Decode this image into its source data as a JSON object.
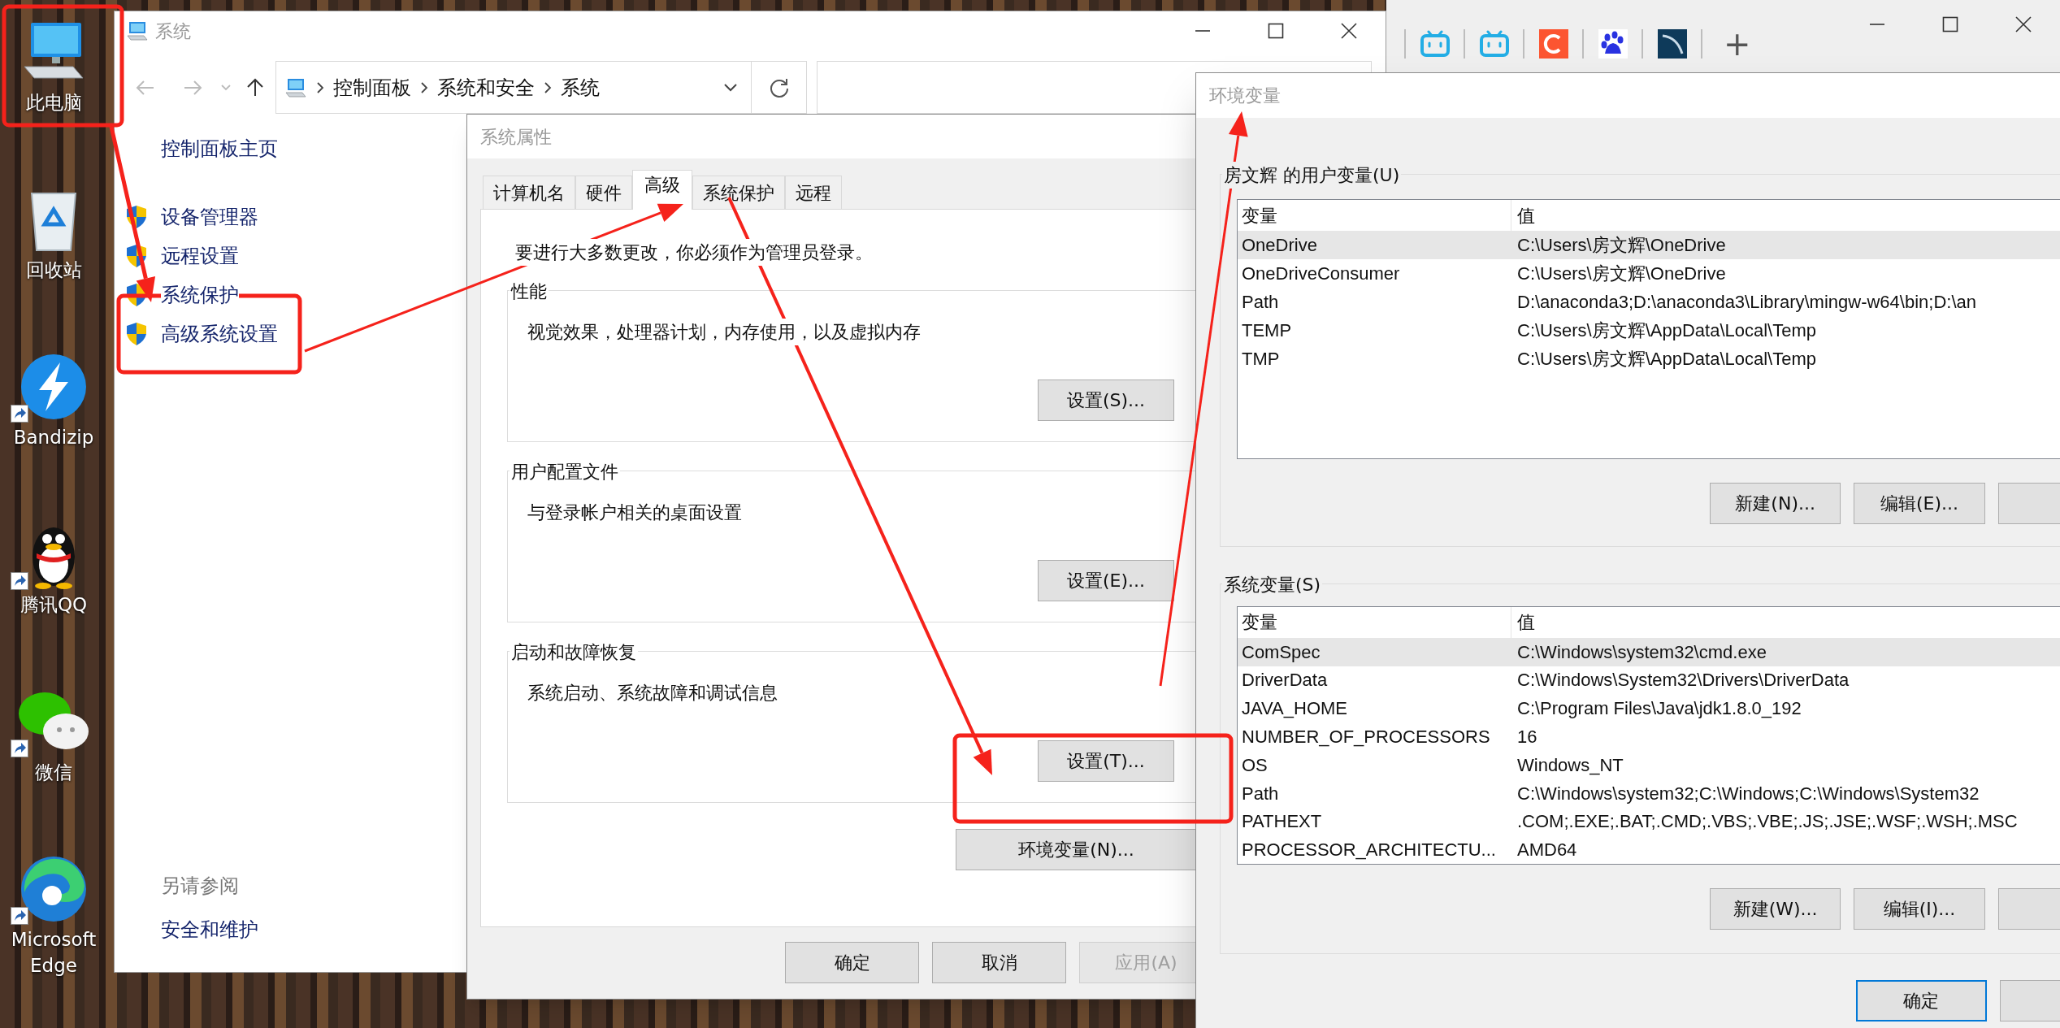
{
  "desktop": {
    "icons": [
      {
        "label": "此电脑",
        "kind": "computer",
        "shortcut": false
      },
      {
        "label": "回收站",
        "kind": "recycle_bin",
        "shortcut": false
      },
      {
        "label": "Bandizip",
        "kind": "bandizip",
        "shortcut": true
      },
      {
        "label": "腾讯QQ",
        "kind": "qq",
        "shortcut": true
      },
      {
        "label": "微信",
        "kind": "wechat",
        "shortcut": true
      },
      {
        "label": "Microsoft Edge",
        "kind": "edge",
        "shortcut": true
      }
    ]
  },
  "system_window": {
    "title": "系统",
    "breadcrumb": [
      "控制面板",
      "系统和安全",
      "系统"
    ],
    "sidebar": {
      "home": "控制面板主页",
      "items": [
        "设备管理器",
        "远程设置",
        "系统保护",
        "高级系统设置"
      ],
      "see_also_heading": "另请参阅",
      "see_also_links": [
        "安全和维护"
      ]
    }
  },
  "browser": {
    "new_tab_button": "+"
  },
  "system_properties": {
    "title": "系统属性",
    "tabs": [
      {
        "label": "计算机名",
        "selected": false
      },
      {
        "label": "硬件",
        "selected": false
      },
      {
        "label": "高级",
        "selected": true
      },
      {
        "label": "系统保护",
        "selected": false
      },
      {
        "label": "远程",
        "selected": false
      }
    ],
    "notice": "要进行大多数更改，你必须作为管理员登录。",
    "groups": [
      {
        "title": "性能",
        "description": "视觉效果，处理器计划，内存使用，以及虚拟内存",
        "button": "设置(S)..."
      },
      {
        "title": "用户配置文件",
        "description": "与登录帐户相关的桌面设置",
        "button": "设置(E)..."
      },
      {
        "title": "启动和故障恢复",
        "description": "系统启动、系统故障和调试信息",
        "button": "设置(T)..."
      }
    ],
    "env_button": "环境变量(N)...",
    "buttons": [
      {
        "label": "确定",
        "disabled": false
      },
      {
        "label": "取消",
        "disabled": false
      },
      {
        "label": "应用(A)",
        "disabled": true
      }
    ]
  },
  "environment_variables": {
    "title": "环境变量",
    "user_group": {
      "title": "房文辉 的用户变量(U)",
      "columns": [
        "变量",
        "值"
      ],
      "rows": [
        {
          "name": "OneDrive",
          "value": "C:\\Users\\房文辉\\OneDrive",
          "selected": true
        },
        {
          "name": "OneDriveConsumer",
          "value": "C:\\Users\\房文辉\\OneDrive",
          "selected": false
        },
        {
          "name": "Path",
          "value": "D:\\anaconda3;D:\\anaconda3\\Library\\mingw-w64\\bin;D:\\an",
          "selected": false
        },
        {
          "name": "TEMP",
          "value": "C:\\Users\\房文辉\\AppData\\Local\\Temp",
          "selected": false
        },
        {
          "name": "TMP",
          "value": "C:\\Users\\房文辉\\AppData\\Local\\Temp",
          "selected": false
        }
      ],
      "buttons": [
        "新建(N)...",
        "编辑(E)..."
      ]
    },
    "system_group": {
      "title": "系统变量(S)",
      "columns": [
        "变量",
        "值"
      ],
      "rows": [
        {
          "name": "ComSpec",
          "value": "C:\\Windows\\system32\\cmd.exe",
          "selected": true
        },
        {
          "name": "DriverData",
          "value": "C:\\Windows\\System32\\Drivers\\DriverData",
          "selected": false
        },
        {
          "name": "JAVA_HOME",
          "value": "C:\\Program Files\\Java\\jdk1.8.0_192",
          "selected": false
        },
        {
          "name": "NUMBER_OF_PROCESSORS",
          "value": "16",
          "selected": false
        },
        {
          "name": "OS",
          "value": "Windows_NT",
          "selected": false
        },
        {
          "name": "Path",
          "value": "C:\\Windows\\system32;C:\\Windows;C:\\Windows\\System32",
          "selected": false
        },
        {
          "name": "PATHEXT",
          "value": ".COM;.EXE;.BAT;.CMD;.VBS;.VBE;.JS;.JSE;.WSF;.WSH;.MSC",
          "selected": false
        },
        {
          "name": "PROCESSOR_ARCHITECTU...",
          "value": "AMD64",
          "selected": false
        }
      ],
      "buttons": [
        "新建(W)...",
        "编辑(I)..."
      ]
    },
    "buttons": [
      {
        "label": "确定",
        "default": true
      }
    ]
  }
}
